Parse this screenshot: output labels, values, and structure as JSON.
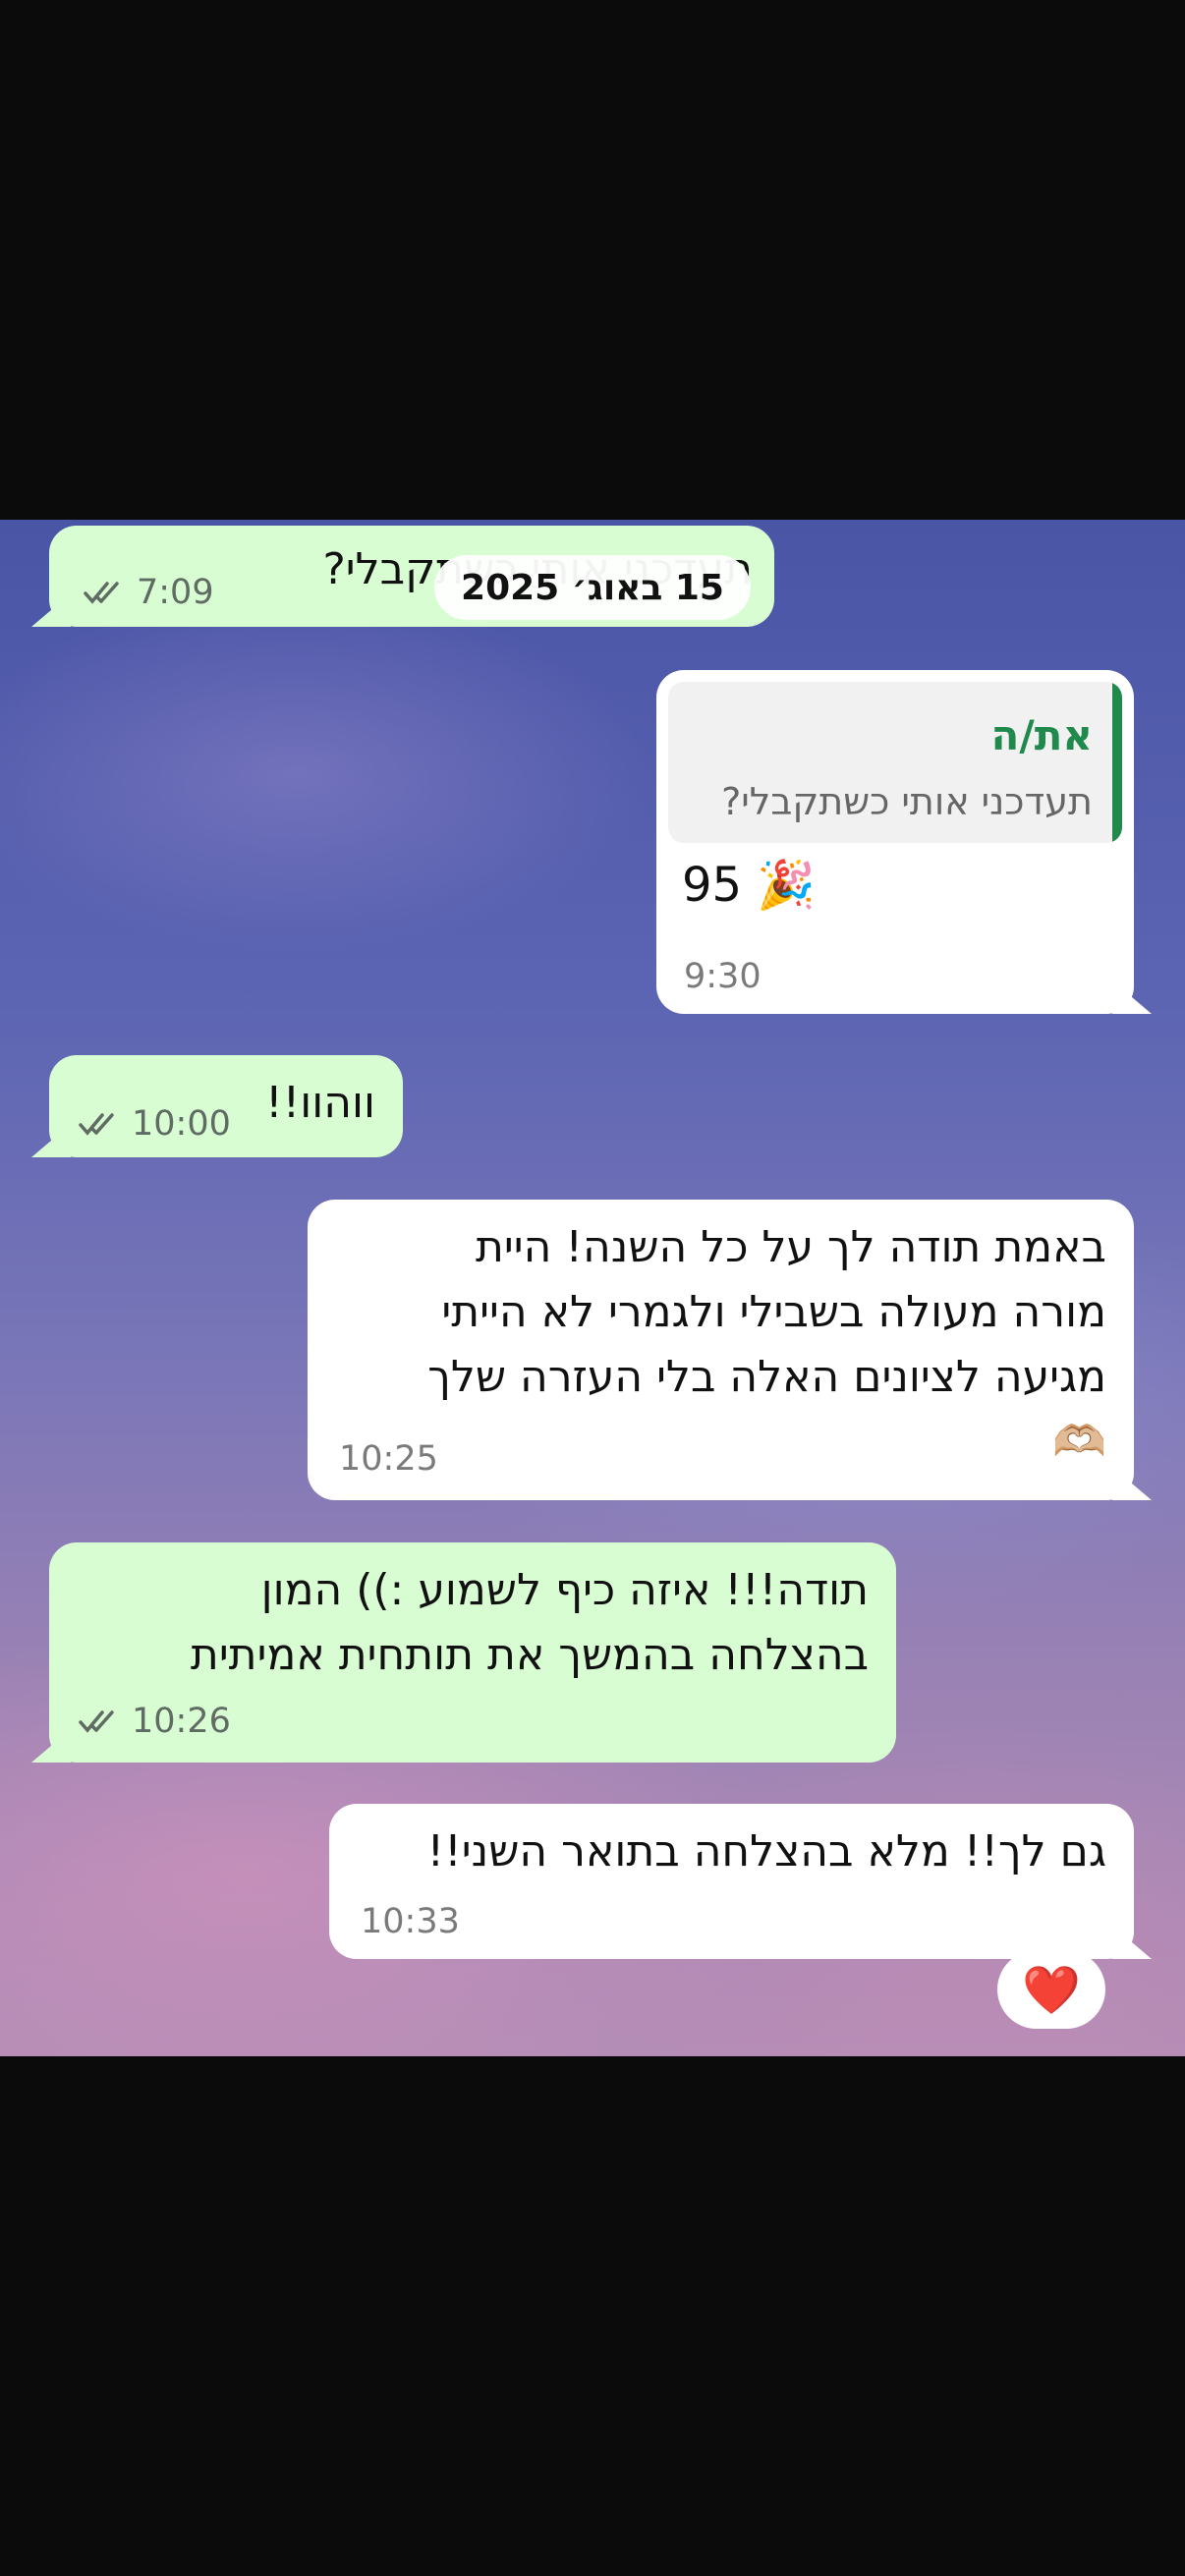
{
  "date_separator": "15 באוג׳ 2025",
  "messages": [
    {
      "id": "m1",
      "direction": "outgoing",
      "text": "תעדכני אותי כשתקבלי?",
      "time": "7:09",
      "status": "read"
    },
    {
      "id": "m2",
      "direction": "incoming",
      "quote": {
        "author": "את/ה",
        "text": "תעדכני אותי כשתקבלי?"
      },
      "text": "95 🎉",
      "time": "9:30"
    },
    {
      "id": "m3",
      "direction": "outgoing",
      "text": "ווהוו!!",
      "time": "10:00",
      "status": "read"
    },
    {
      "id": "m4",
      "direction": "incoming",
      "lines": [
        "באמת תודה לך על כל השנה! היית",
        "מורה מעולה בשבילי ולגמרי לא הייתי",
        "מגיעה לציונים האלה בלי העזרה שלך",
        "🫶🏼"
      ],
      "time": "10:25"
    },
    {
      "id": "m5",
      "direction": "outgoing",
      "lines": [
        "תודה!!! איזה כיף לשמוע :)) המון",
        "בהצלחה בהמשך את תותחית אמיתית"
      ],
      "time": "10:26",
      "status": "read"
    },
    {
      "id": "m6",
      "direction": "incoming",
      "text": "גם לך!! מלא בהצלחה בתואר השני!!",
      "time": "10:33",
      "reaction": "❤️"
    }
  ],
  "colors": {
    "outgoing_bubble": "#d9fdd3",
    "incoming_bubble": "#ffffff",
    "quote_accent": "#1f8a4c",
    "read_ticks": "#5f6b63"
  },
  "icons": {
    "read_status": "double-check-icon"
  }
}
